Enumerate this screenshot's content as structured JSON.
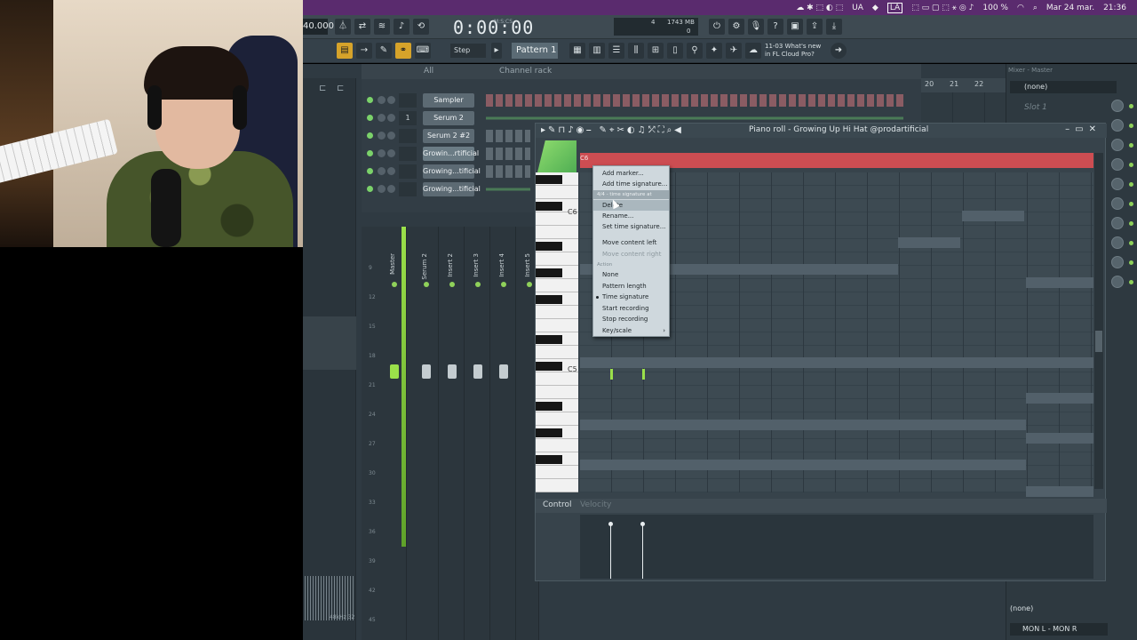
{
  "menubar": {
    "items": [
      "UA",
      "100 %",
      "Mar 24 mar.",
      "21:36"
    ],
    "layout_badge": "LA"
  },
  "toolbar": {
    "tempo": "40.000",
    "time": "0:00:00",
    "time_unit": "M:S:CS",
    "cpu_mem": "1743 MB",
    "cpu_a": "4",
    "cpu_b": "0",
    "step_mode": "Step",
    "pattern": "Pattern 1",
    "hint_line1": "11-03  What's new",
    "hint_line2": "in FL Cloud Pro?"
  },
  "channel_rack": {
    "filter": "All",
    "title": "Channel rack",
    "add_label": "+",
    "channels": [
      {
        "num": "",
        "name": "Sampler",
        "steps": "red"
      },
      {
        "num": "1",
        "name": "Serum 2",
        "steps": "green"
      },
      {
        "num": "",
        "name": "Serum 2 #2",
        "steps": "plain"
      },
      {
        "num": "",
        "name": "Growin...rtificial",
        "steps": "plain",
        "selected": true
      },
      {
        "num": "",
        "name": "Growing...tificial",
        "steps": "plain"
      },
      {
        "num": "",
        "name": "Growing...tificial",
        "steps": "green"
      }
    ]
  },
  "mixer": {
    "strips": [
      "Master",
      "Serum 2",
      "Insert 2",
      "Insert 3",
      "Insert 4",
      "Insert 5"
    ],
    "scale": [
      "9",
      "12",
      "15",
      "18",
      "21",
      "24",
      "27",
      "30",
      "33",
      "36",
      "39",
      "42",
      "45"
    ],
    "wave_label": "48kHz 32"
  },
  "piano_roll": {
    "title": "Piano roll - Growing Up Hi Hat @prodartificial",
    "timeline_marker": "C6",
    "octave_labels": [
      "C6",
      "C5"
    ],
    "control_label": "Control",
    "control_value": "Velocity"
  },
  "context_menu": {
    "items": [
      {
        "label": "Add marker...",
        "type": "item"
      },
      {
        "label": "Add time signature...",
        "type": "item"
      },
      {
        "label": "4/4 - time signature at 1:01:00",
        "type": "section"
      },
      {
        "label": "Delete",
        "type": "item",
        "highlight": true
      },
      {
        "label": "Rename...",
        "type": "item"
      },
      {
        "label": "Set time signature...",
        "type": "item"
      },
      {
        "label": "Move content left",
        "type": "item"
      },
      {
        "label": "Move content right",
        "type": "item",
        "disabled": true
      },
      {
        "label": "Action",
        "type": "section_plain"
      },
      {
        "label": "None",
        "type": "item"
      },
      {
        "label": "Pattern length",
        "type": "item"
      },
      {
        "label": "Time signature",
        "type": "item",
        "checked": true
      },
      {
        "label": "Start recording",
        "type": "item"
      },
      {
        "label": "Stop recording",
        "type": "item"
      },
      {
        "label": "Key/scale",
        "type": "item",
        "submenu": true
      }
    ]
  },
  "playlist": {
    "bars": [
      "20",
      "21",
      "22"
    ]
  },
  "mixer_right": {
    "title": "Mixer - Master",
    "select": "(none)",
    "slot": "Slot 1",
    "bottom_select": "(none)",
    "routing": "MON L - MON R"
  },
  "colors": {
    "timeline_red": "#cd4d52",
    "accent_green": "#9be04a",
    "menubar_purple": "#5a2b6e"
  }
}
